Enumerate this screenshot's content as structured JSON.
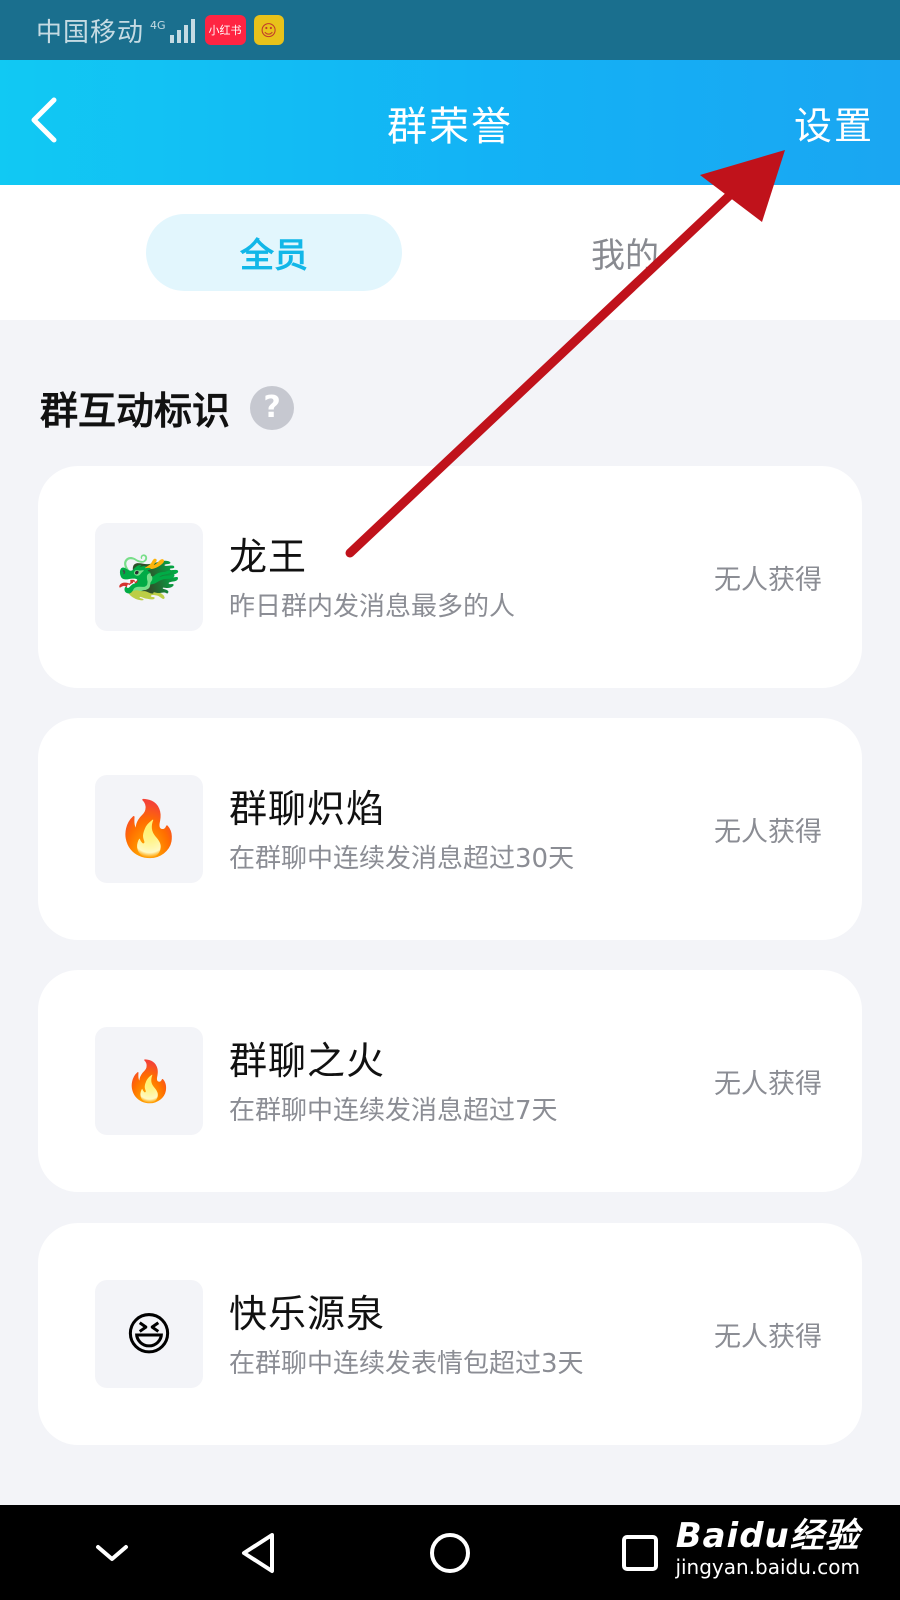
{
  "status_bar": {
    "carrier": "中国移动",
    "network": "4G",
    "app_badge": "小红书"
  },
  "header": {
    "title": "群荣誉",
    "settings_label": "设置"
  },
  "tabs": [
    {
      "label": "全员",
      "active": true
    },
    {
      "label": "我的",
      "active": false
    }
  ],
  "section": {
    "title": "群互动标识",
    "help_symbol": "?"
  },
  "honors": [
    {
      "name": "龙王",
      "description": "昨日群内发消息最多的人",
      "status": "无人获得",
      "icon": "dragon-icon",
      "emoji": "🐲"
    },
    {
      "name": "群聊炽焰",
      "description": "在群聊中连续发消息超过30天",
      "status": "无人获得",
      "icon": "campfire-icon",
      "emoji": "🔥"
    },
    {
      "name": "群聊之火",
      "description": "在群聊中连续发消息超过7天",
      "status": "无人获得",
      "icon": "fire-icon",
      "emoji": "🔥"
    },
    {
      "name": "快乐源泉",
      "description": "在群聊中连续发表情包超过3天",
      "status": "无人获得",
      "icon": "happy-flower-icon",
      "emoji": "😆"
    }
  ],
  "watermark": {
    "logo": "Baidu经验",
    "url": "jingyan.baidu.com"
  },
  "colors": {
    "header_gradient_start": "#11c9f3",
    "header_gradient_end": "#1aa6f2",
    "active_tab_bg": "#e2f6fd",
    "active_tab_text": "#12b7e8",
    "annotation_arrow": "#c0121b"
  }
}
